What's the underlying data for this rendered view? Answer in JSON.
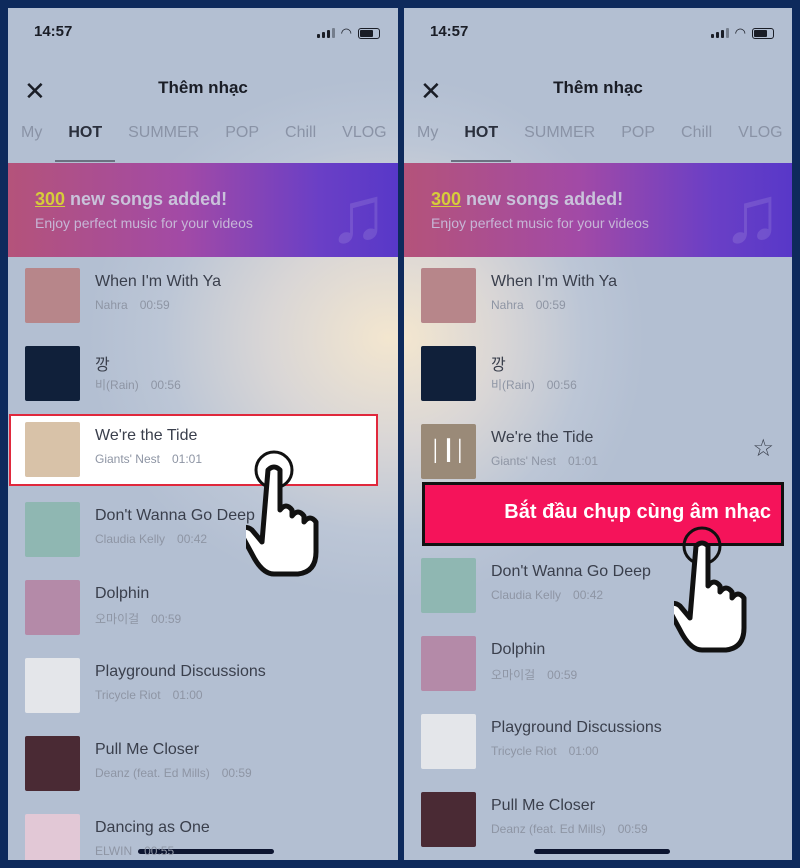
{
  "status": {
    "time": "14:57"
  },
  "header": {
    "title": "Thêm nhạc",
    "close_icon": "close-icon"
  },
  "tabs": [
    "My",
    "HOT",
    "SUMMER",
    "POP",
    "Chill",
    "VLOG"
  ],
  "active_tab": "HOT",
  "banner": {
    "count": "300",
    "headline": " new songs added!",
    "subtitle": "Enjoy perfect music for your videos"
  },
  "songs": [
    {
      "title": "When I'm With Ya",
      "artist": "Nahra",
      "duration": "00:59",
      "color": "#b7868a"
    },
    {
      "title": "깡",
      "artist": "비(Rain)",
      "duration": "00:56",
      "color": "#10203a"
    },
    {
      "title": "We're the Tide",
      "artist": "Giants' Nest",
      "duration": "01:01",
      "color": "#d8c2a8"
    },
    {
      "title": "Don't Wanna Go Deep",
      "artist": "Claudia Kelly",
      "duration": "00:42",
      "color": "#8fb7b2"
    },
    {
      "title": "Dolphin",
      "artist": "오마이걸",
      "duration": "00:59",
      "color": "#b48aa8"
    },
    {
      "title": "Playground Discussions",
      "artist": "Tricycle Riot",
      "duration": "01:00",
      "color": "#e4e6ea"
    },
    {
      "title": "Pull Me Closer",
      "artist": "Deanz (feat. Ed Mills)",
      "duration": "00:59",
      "color": "#4a2a34"
    },
    {
      "title": "Dancing as One",
      "artist": "ELWIN",
      "duration": "00:55",
      "color": "#e2c8d6"
    }
  ],
  "cta": {
    "label": "Bắt đầu chụp cùng âm nhạc"
  },
  "colors": {
    "highlight_border": "#e0283c",
    "cta": "#f5135a",
    "accent": "#d6cc3a"
  }
}
